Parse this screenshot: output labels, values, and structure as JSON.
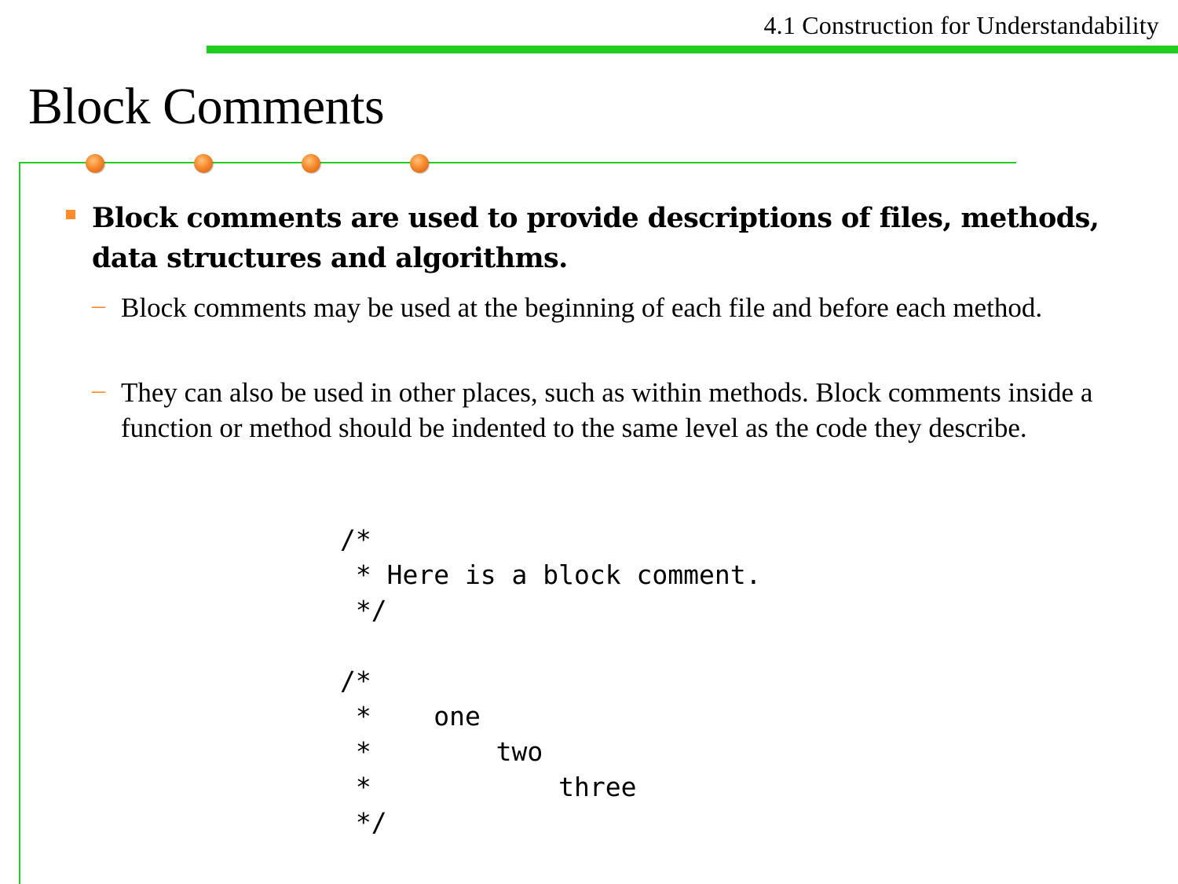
{
  "header": {
    "section_title": "4.1 Construction for Understandability"
  },
  "slide": {
    "title": "Block Comments"
  },
  "content": {
    "bullet": "Block comments are used to provide descriptions of files, methods, data structures and algorithms.",
    "sub_items": [
      {
        "text": "Block comments may be used at the beginning of each file and before each method."
      },
      {
        "text": "They can also be used in other places, such as within methods. Block comments inside a function or method should be indented to the same level as the code they describe."
      }
    ],
    "code_example": "/*\n * Here is a block comment.\n */\n\n/*\n *    one\n *        two\n *            three\n */"
  },
  "colors": {
    "accent_green": "#1fce1f",
    "accent_orange": "#ff8a2a"
  }
}
